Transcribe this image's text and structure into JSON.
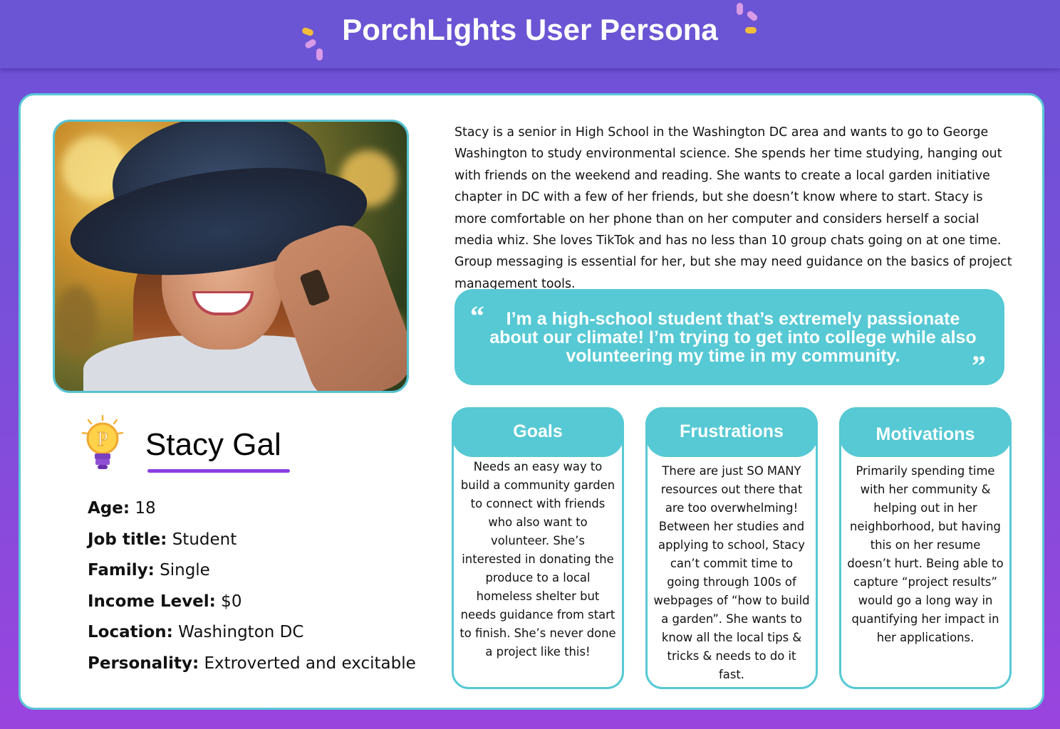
{
  "header": {
    "title": "PorchLights User Persona"
  },
  "persona": {
    "name": "Stacy Gal",
    "attributes": [
      {
        "label": "Age:",
        "value": " 18"
      },
      {
        "label": "Job title:",
        "value": " Student"
      },
      {
        "label": "Family:",
        "value": " Single"
      },
      {
        "label": "Income Level:",
        "value": " $0"
      },
      {
        "label": "Location:",
        "value": " Washington DC"
      },
      {
        "label": "Personality:",
        "value": " Extroverted and excitable"
      }
    ],
    "bio": "Stacy is a senior in High School in the Washington DC area and wants to go to George Washington to study environmental science. She spends her time studying, hanging out with friends on the weekend and reading. She wants to create a local garden initiative chapter in DC with a few of her friends, but she doesn’t know where to start. Stacy is more comfortable on her phone than on her computer and considers herself a social media whiz. She loves TikTok and has no less than 10 group chats going on at one time. Group messaging is essential for her, but she may need guidance on the basics of project management tools.",
    "quote": "I’m a high-school student that’s extremely passionate about our climate! I’m trying to get into college while also volunteering my time in my community.",
    "quote_open": "“",
    "quote_close": "”"
  },
  "sections": {
    "goals": {
      "title": "Goals",
      "text": "Needs an easy way to build a community garden to connect with friends who also want to volunteer. She’s interested in donating the produce to a local homeless shelter but needs guidance from start to finish. She’s never done a project like this!"
    },
    "frustrations": {
      "title": "Frustrations",
      "text": "There are just SO MANY resources out there that are too overwhelming! Between her studies and applying to school, Stacy can’t commit time to going through 100s of webpages of “how to build a garden”. She wants to know all the local tips & tricks & needs to do it fast."
    },
    "motivations": {
      "title": "Motivations",
      "text": "Primarily spending time with her community & helping out in her neighborhood, but having this on her resume doesn’t hurt. Being able to capture “project results” would go a long way in quantifying her impact in her applications."
    }
  },
  "colors": {
    "accent": "#56c9d4",
    "header": "#6b55d4",
    "underline": "#8a3fe0"
  },
  "icons": [
    "lightbulb-logo-icon",
    "quote-open-icon",
    "quote-close-icon"
  ]
}
